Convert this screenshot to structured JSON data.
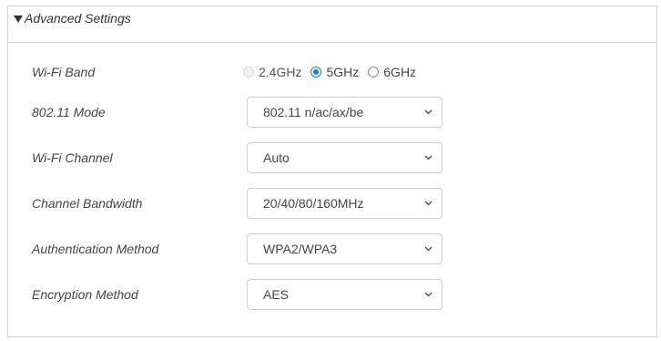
{
  "section": {
    "title": "Advanced Settings",
    "toggle_icon": "triangle-down-icon"
  },
  "wifi_band": {
    "label": "Wi-Fi Band",
    "options": [
      {
        "label": "2.4GHz",
        "checked": false,
        "disabled": true
      },
      {
        "label": "5GHz",
        "checked": true,
        "disabled": false
      },
      {
        "label": "6GHz",
        "checked": false,
        "disabled": false
      }
    ]
  },
  "mode_802_11": {
    "label": "802.11 Mode",
    "value": "802.11 n/ac/ax/be"
  },
  "wifi_channel": {
    "label": "Wi-Fi Channel",
    "value": "Auto"
  },
  "channel_bandwidth": {
    "label": "Channel Bandwidth",
    "value": "20/40/80/160MHz"
  },
  "authentication_method": {
    "label": "Authentication Method",
    "value": "WPA2/WPA3"
  },
  "encryption_method": {
    "label": "Encryption Method",
    "value": "AES"
  },
  "colors": {
    "accent": "#1a73e8",
    "border": "#cfcfcf",
    "text": "#444444"
  }
}
